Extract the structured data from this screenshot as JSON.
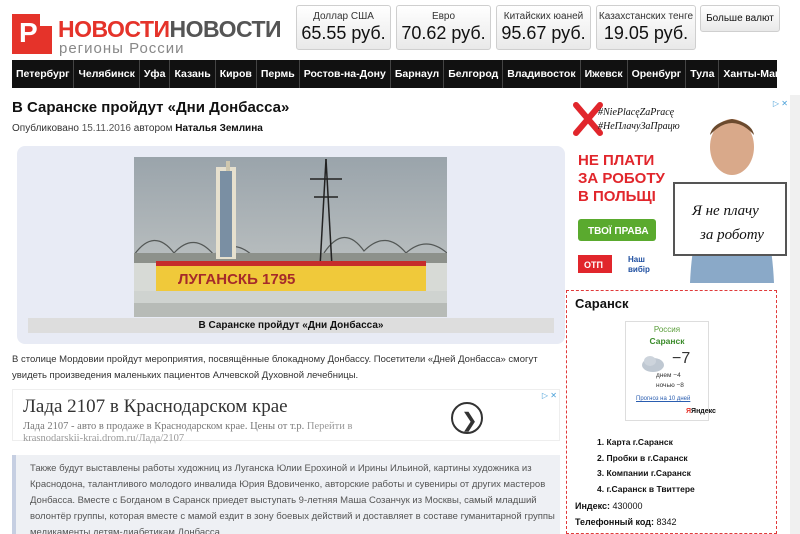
{
  "logo": {
    "badge": "P",
    "part1": "НОВОСТИ",
    "part2": "НОВОСТИ",
    "subtitle": "регионы России"
  },
  "currencies": [
    {
      "label": "Доллар США",
      "value": "65.55 руб."
    },
    {
      "label": "Евро",
      "value": "70.62 руб."
    },
    {
      "label": "Китайских юаней",
      "value": "95.67 руб."
    },
    {
      "label": "Казахстанских тенге",
      "value": "19.05 руб."
    }
  ],
  "more_currencies": "Больше валют",
  "nav": [
    "Петербург",
    "Челябинск",
    "Уфа",
    "Казань",
    "Киров",
    "Пермь",
    "Ростов-на-Дону",
    "Барнаул",
    "Белгород",
    "Владивосток",
    "Ижевск",
    "Оренбург",
    "Тула",
    "Ханты-Мансийск"
  ],
  "article": {
    "title": "В Саранске пройдут «Дни Донбасса»",
    "published_prefix": "Опубликовано",
    "date": "15.11.2016",
    "author_prefix": "автором",
    "author": "Наталья Землина",
    "image_caption": "В Саранске пройдут «Дни Донбасса»",
    "photo_sign": "ЛУГАНСКЬ 1795",
    "lead": "В столице Мордовии пройдут мероприятия, посвящённые блокадному Донбассу. Посетители «Дней Донбасса» смогут увидеть произведения маленьких пациентов Алчевской Духовной лечебницы.",
    "quote": "Также будут выставлены работы художниц из Луганска Юлии Ерохиной и Ирины Ильиной, картины художника из Краснодона, талантливого молодого инвалида Юрия Вдовиченко, авторские работы и сувениры от других мастеров Донбасса. Вместе с Богданом в Саранск приедет выступать 9-летняя Маша Созанчук из Москвы, самый младший волонтёр группы, которая вместе с мамой ездит в зону боевых действий и доставляет в составе гуманитарной группы медикаменты детям-диабетикам Донбасса."
  },
  "google_ad": {
    "title": "Лада 2107 в Краснодарском крае",
    "text": "Лада 2107 - авто в продаже в Краснодарском крае. Цены от т.р.",
    "cta": "Перейти в",
    "url": "krasnodarskii-krai.drom.ru/Лада/2107",
    "arrow": "❯"
  },
  "side_ad": {
    "hashtag1": "#NiePlacęZaPracę",
    "hashtag2": "#НеПлачуЗаПрацю",
    "headline1": "НЕ ПЛАТИ",
    "headline2": "ЗА РОБОТУ",
    "headline3": "В ПОЛЬЩІ",
    "button": "ТВОЇ ПРАВА",
    "sign1": "Я не плачу",
    "sign2": "за роботу",
    "logo_left": "ОТП",
    "logo_right1": "Наш",
    "logo_right2": "вибір"
  },
  "widget": {
    "title": "Саранск",
    "weather": {
      "country": "Россия",
      "city": "Саранск",
      "temp": "−7",
      "day": "днем −4",
      "night": "ночью −8",
      "forecast_link": "Прогноз на 10 дней",
      "brand": "Яндекс"
    },
    "links": [
      "Карта г.Саранск",
      "Пробки в г.Саранск",
      "Компании г.Саранск",
      "г.Саранск в Твиттере"
    ],
    "index_label": "Индекс:",
    "index_value": "430000",
    "tel_label": "Телефонный код:",
    "tel_value": "8342"
  }
}
